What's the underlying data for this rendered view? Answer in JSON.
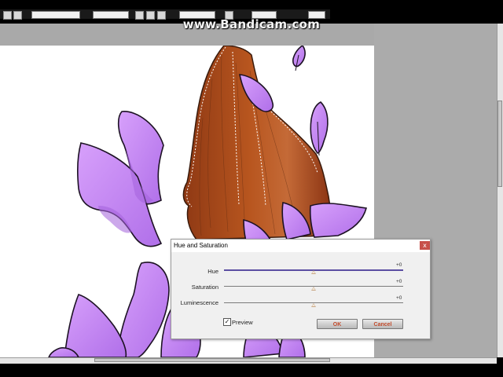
{
  "watermark": {
    "text": "www.Bandicam.com"
  },
  "dialog": {
    "title": "Hue and Saturation",
    "close_label": "x",
    "rows": [
      {
        "label": "Hue",
        "value": "+0"
      },
      {
        "label": "Saturation",
        "value": "+0"
      },
      {
        "label": "Luminescence",
        "value": "+0"
      }
    ],
    "slider_levels": [
      0.5,
      0.5,
      0.5
    ],
    "preview": {
      "label": "Preview",
      "checked": true,
      "check_glyph": "✓"
    },
    "ok_label": "OK",
    "cancel_label": "Cancel"
  },
  "colors": {
    "petal": "#c98bf5",
    "petal_dark": "#a462dc",
    "flame": "#a7481e",
    "flame_light": "#c46a37",
    "hue_track": "#5b4ea2",
    "button_text": "#c24a2b",
    "close_button": "#c7504a"
  }
}
